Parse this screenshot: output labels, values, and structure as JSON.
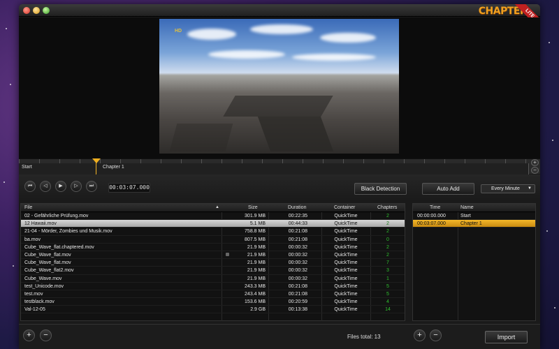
{
  "app": {
    "logo": "CHAPTER",
    "logo_sub": "it",
    "edition_badge": "LITE"
  },
  "video": {
    "channel_logo": "HD"
  },
  "timeline": {
    "chapters": [
      {
        "label": "Start"
      },
      {
        "label": "Chapter 1"
      }
    ]
  },
  "transport": {
    "timecode": "00:03:07.000",
    "black_detection_label": "Black Detection",
    "auto_add_label": "Auto Add",
    "interval_selected": "Every Minute"
  },
  "files_table": {
    "headers": {
      "file": "File",
      "size": "Size",
      "duration": "Duration",
      "container": "Container",
      "chapters": "Chapters"
    },
    "rows": [
      {
        "file": "02 - Gefährliche Prüfung.mov",
        "size": "301.9 MB",
        "duration": "00:22:35",
        "container": "QuickTime",
        "chapters": "2"
      },
      {
        "file": "12 Hawaii.mov",
        "size": "5.1 MB",
        "duration": "00:44:33",
        "container": "QuickTime",
        "chapters": "2"
      },
      {
        "file": "21-04 - Mörder, Zombies und Musik.mov",
        "size": "758.8 MB",
        "duration": "00:21:08",
        "container": "QuickTime",
        "chapters": "2"
      },
      {
        "file": "ba.mov",
        "size": "807.5 MB",
        "duration": "00:21:08",
        "container": "QuickTime",
        "chapters": "0"
      },
      {
        "file": "Cube_Wave_flat.chaptered.mov",
        "size": "21.9 MB",
        "duration": "00:00:32",
        "container": "QuickTime",
        "chapters": "2"
      },
      {
        "file": "Cube_Wave_flat.mov",
        "size": "21.9 MB",
        "duration": "00:00:32",
        "container": "QuickTime",
        "chapters": "2"
      },
      {
        "file": "Cube_Wave_flat.mov",
        "size": "21.9 MB",
        "duration": "00:00:32",
        "container": "QuickTime",
        "chapters": "7"
      },
      {
        "file": "Cube_Wave_flat2.mov",
        "size": "21.9 MB",
        "duration": "00:00:32",
        "container": "QuickTime",
        "chapters": "3"
      },
      {
        "file": "Cube_Wave.mov",
        "size": "21.9 MB",
        "duration": "00:00:32",
        "container": "QuickTime",
        "chapters": "1"
      },
      {
        "file": "test_Unicode.mov",
        "size": "243.3 MB",
        "duration": "00:21:08",
        "container": "QuickTime",
        "chapters": "5"
      },
      {
        "file": "test.mov",
        "size": "243.4 MB",
        "duration": "00:21:08",
        "container": "QuickTime",
        "chapters": "5"
      },
      {
        "file": "testblack.mov",
        "size": "153.6 MB",
        "duration": "00:20:59",
        "container": "QuickTime",
        "chapters": "4"
      },
      {
        "file": "Val-12-05",
        "size": "2.9 GB",
        "duration": "00:13:38",
        "container": "QuickTime",
        "chapters": "14"
      }
    ],
    "selected_index": 1
  },
  "chapters_table": {
    "headers": {
      "time": "Time",
      "name": "Name"
    },
    "rows": [
      {
        "time": "00:00:00.000",
        "name": "Start"
      },
      {
        "time": "00:03:07.000",
        "name": "Chapter 1"
      }
    ],
    "selected_index": 1
  },
  "footer": {
    "files_total": "Files total: 13",
    "import_label": "Import"
  },
  "colors": {
    "accent": "#f0b020",
    "chapter_count": "#2fc02f"
  }
}
